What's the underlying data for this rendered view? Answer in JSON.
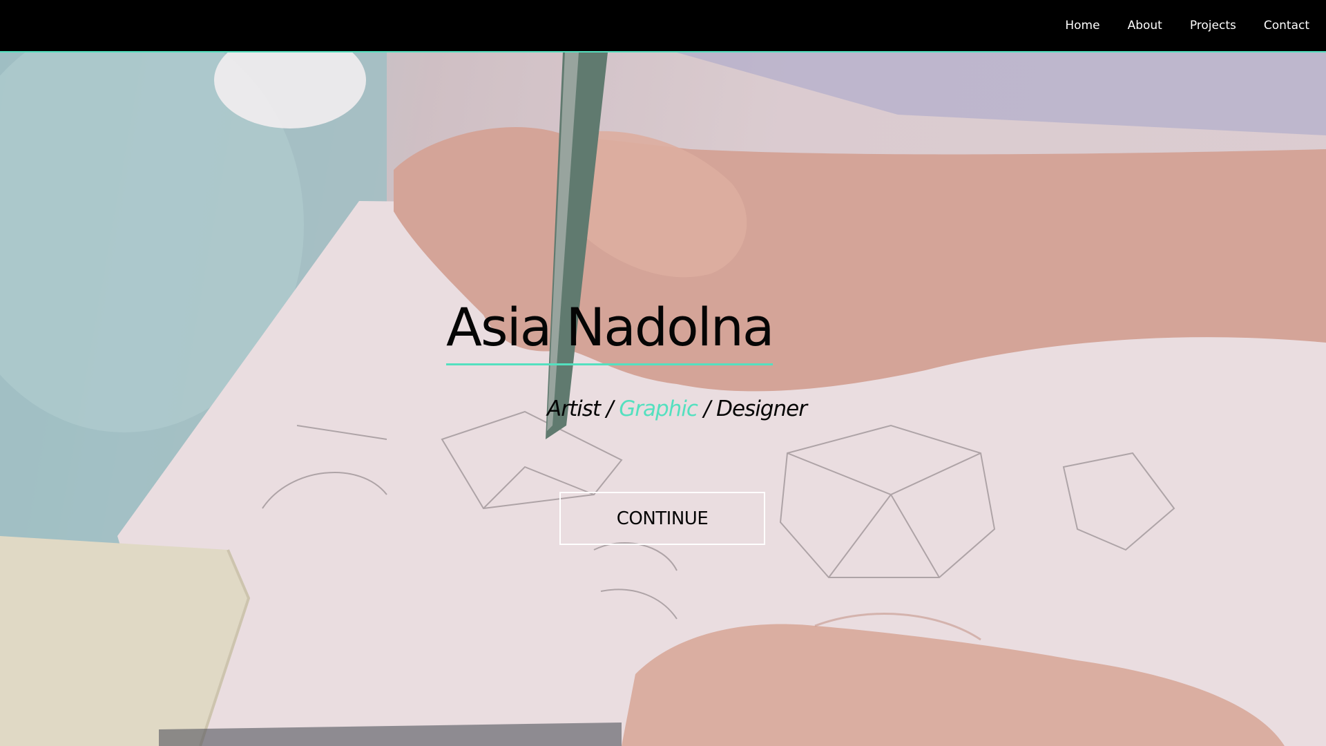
{
  "nav": {
    "items": [
      {
        "label": "Home"
      },
      {
        "label": "About"
      },
      {
        "label": "Projects"
      },
      {
        "label": "Contact"
      }
    ]
  },
  "hero": {
    "title": "Asia Nadolna",
    "subtitle": {
      "part1": "Artist / ",
      "accent": "Graphic",
      "part2": " / Designer"
    },
    "button_label": "CONTINUE",
    "background_image": "photo-of-hands-sketching-on-paper"
  },
  "colors": {
    "accent": "#54e0bf",
    "navbar_bg": "#000000",
    "text": "#050505"
  }
}
